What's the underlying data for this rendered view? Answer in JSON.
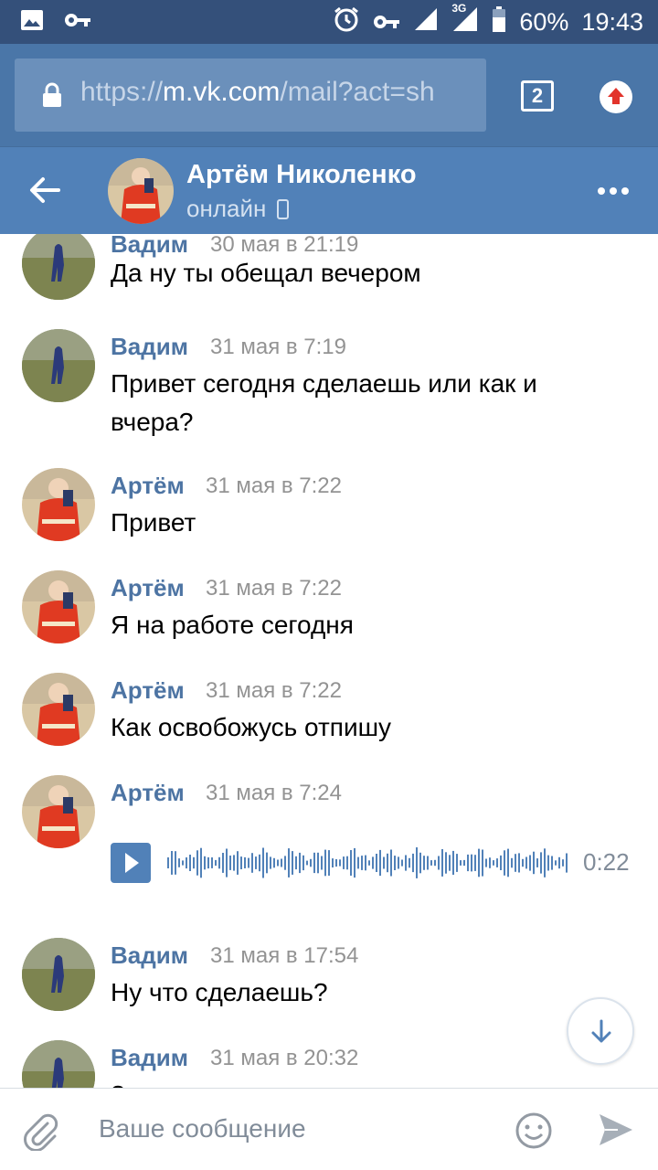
{
  "status_bar": {
    "battery": "60%",
    "time": "19:43",
    "network": "3G"
  },
  "browser": {
    "url_scheme": "https://",
    "url_host": "m.vk.com",
    "url_path": "/mail?act=sh",
    "tab_count": "2"
  },
  "chat": {
    "title": "Артём Николенко",
    "status": "онлайн"
  },
  "messages": [
    {
      "author": "Вадим",
      "time": "30 мая в 21:19",
      "text": "Да ну ты обещал вечером"
    },
    {
      "author": "Вадим",
      "time": "31 мая в 7:19",
      "text": "Привет сегодня сделаешь или как и вчера?"
    },
    {
      "author": "Артём",
      "time": "31 мая в 7:22",
      "text": "Привет"
    },
    {
      "author": "Артём",
      "time": "31 мая в 7:22",
      "text": "Я на работе сегодня"
    },
    {
      "author": "Артём",
      "time": "31 мая в 7:22",
      "text": "Как освобожусь отпишу"
    },
    {
      "author": "Артём",
      "time": "31 мая в 7:24",
      "voice_duration": "0:22"
    },
    {
      "author": "Вадим",
      "time": "31 мая в 17:54",
      "text": "Ну что сделаешь?"
    },
    {
      "author": "Вадим",
      "time": "31 мая в 20:32",
      "text": "?"
    }
  ],
  "composer": {
    "placeholder": "Ваше сообщение"
  },
  "icons": {
    "image": "image-icon",
    "key": "key-icon",
    "alarm": "alarm-icon",
    "signal": "signal-icon",
    "battery": "battery-icon",
    "lock": "lock-icon",
    "upload": "upload-icon",
    "back": "back-arrow-icon",
    "more": "more-dots-icon",
    "phone": "phone-icon",
    "play": "play-icon",
    "scroll_down": "arrow-down-icon",
    "attach": "paperclip-icon",
    "emoji": "smiley-icon",
    "send": "send-icon"
  },
  "colors": {
    "status_bar": "#34507a",
    "browser_bar": "#4a76a8",
    "header": "#5181b8",
    "author": "#4d74a3",
    "time": "#939393",
    "voice_wave": "#5181b8"
  }
}
